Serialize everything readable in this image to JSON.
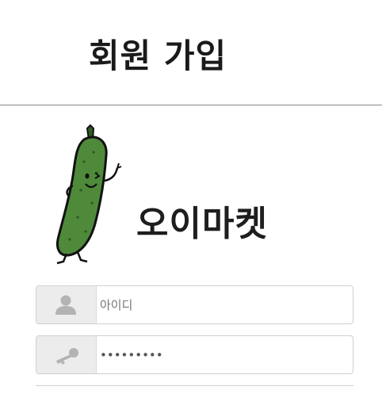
{
  "header": {
    "title": "회원 가입"
  },
  "brand": {
    "name": "오이마켓"
  },
  "form": {
    "id_field": {
      "placeholder": "아이디",
      "value": ""
    },
    "password_field": {
      "placeholder": "",
      "value": "*********"
    }
  },
  "icons": {
    "id_addon": "user-icon",
    "password_addon": "key-icon",
    "mascot": "cucumber-mascot"
  },
  "colors": {
    "addon_bg": "#ececec",
    "cucumber": "#4e8a3a",
    "divider": "#8a8a8a"
  }
}
